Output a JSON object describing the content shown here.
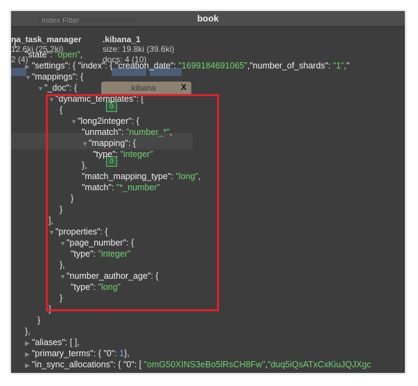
{
  "window": {
    "title": "book"
  },
  "background": {
    "search_placeholder": "Index Filter",
    "index_a_name": "na_task_manager",
    "index_a_size": "12.6ki (25.2ki)",
    "index_a_docs": "2 (4)",
    "index_b_name": ".kibana_1",
    "index_b_size": "size: 19.8ki (39.6ki)",
    "index_b_docs": "docs: 4 (10)",
    "tab_label": ".kibana",
    "tab_close": "X",
    "badge_a": "0",
    "badge_b": "0"
  },
  "json_view": {
    "open_brace": "{",
    "state_key": "\"state\"",
    "state_value": "\"open\"",
    "settings_key": "\"settings\"",
    "settings_index_key": "\"index\"",
    "creation_date_key": "\"creation_date\"",
    "creation_date_value": "\"1699184691065\"",
    "shards_key": "\"number_of_shards\"",
    "shards_value": "\"1\"",
    "mappings_key": "\"mappings\"",
    "doc_key": "\"_doc\"",
    "dynamic_templates_key": "\"dynamic_templates\"",
    "long2integer_key": "\"long2integer\"",
    "unmatch_key": "\"unmatch\"",
    "unmatch_value": "\"number_*\"",
    "mapping_key": "\"mapping\"",
    "type_key": "\"type\"",
    "type_integer": "\"integer\"",
    "match_mapping_type_key": "\"match_mapping_type\"",
    "match_mapping_type_value": "\"long\"",
    "match_key": "\"match\"",
    "match_value": "\"*_number\"",
    "properties_key": "\"properties\"",
    "page_number_key": "\"page_number\"",
    "number_author_age_key": "\"number_author_age\"",
    "type_long": "\"long\"",
    "aliases_key": "\"aliases\"",
    "primary_terms_key": "\"primary_terms\"",
    "primary_terms_inner_key": "\"0\"",
    "primary_terms_value": "1",
    "in_sync_key": "\"in_sync_allocations\"",
    "in_sync_inner_key": "\"0\"",
    "in_sync_value_1": "\"omG50XINS3eBo5lRsCH8Fw\"",
    "in_sync_value_2": "\"duq5iQsATxCxKiuJQJXgc"
  }
}
